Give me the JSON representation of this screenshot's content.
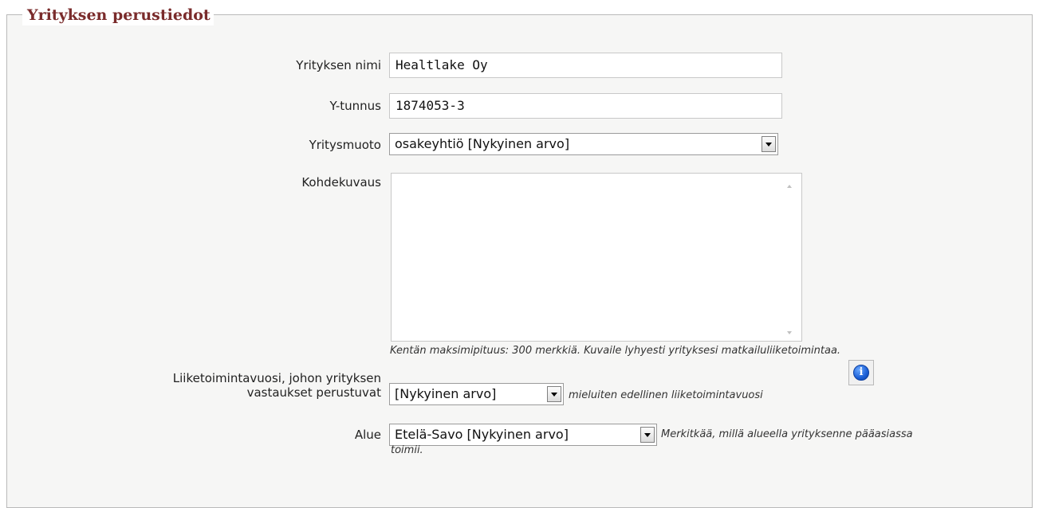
{
  "section": {
    "title": "Yrityksen perustiedot"
  },
  "fields": {
    "company_name": {
      "label": "Yrityksen nimi",
      "value": "Healtlake Oy"
    },
    "business_id": {
      "label": "Y-tunnus",
      "value": "1874053-3"
    },
    "company_form": {
      "label": "Yritysmuoto",
      "selected": "osakeyhtiö [Nykyinen arvo]"
    },
    "description": {
      "label": "Kohdekuvaus",
      "value": "",
      "hint": "Kentän maksimipituus: 300 merkkiä. Kuvaile lyhyesti yrityksesi matkailuliiketoimintaa."
    },
    "fiscal_year": {
      "label_line1": "Liiketoimintavuosi, johon yrityksen",
      "label_line2": "vastaukset perustuvat",
      "selected": "[Nykyinen arvo]",
      "hint": "mieluiten edellinen liiketoimintavuosi",
      "info_icon": "i"
    },
    "region": {
      "label": "Alue",
      "selected": "Etelä-Savo [Nykyinen arvo]",
      "hint_line1": "Merkitkää, millä alueella yrityksenne pääasiassa",
      "hint_line2": "toimii."
    }
  },
  "colors": {
    "legend": "#7a2b2b",
    "panel": "#f6f6f5",
    "info": "#1b5fd6"
  }
}
